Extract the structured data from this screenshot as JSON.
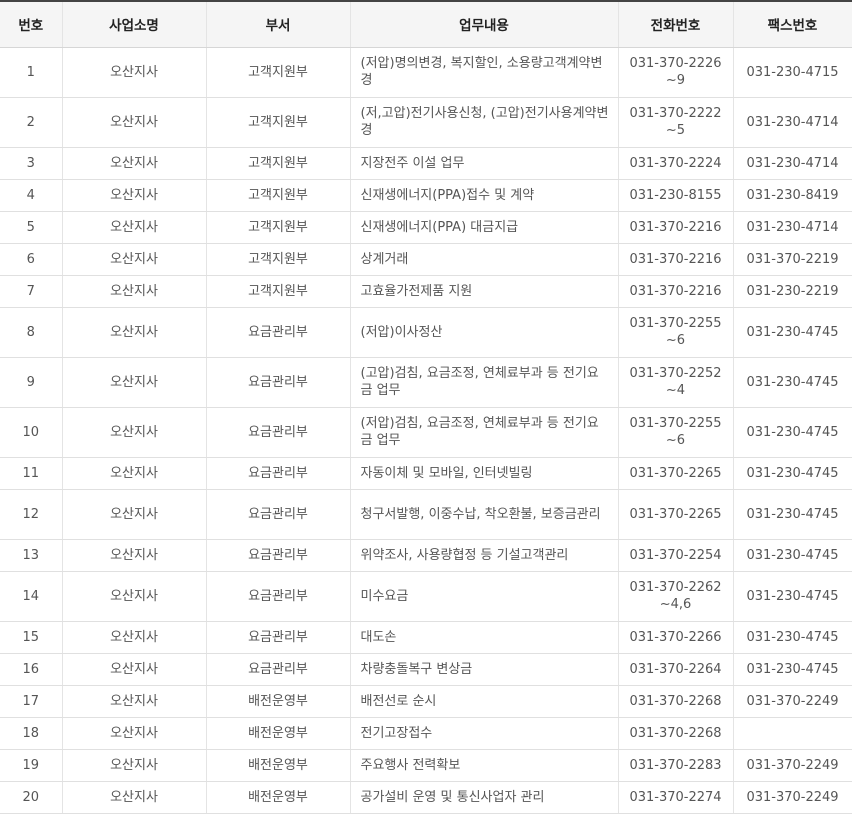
{
  "headers": [
    "번호",
    "사업소명",
    "부서",
    "업무내용",
    "전화번호",
    "팩스번호"
  ],
  "rows": [
    {
      "no": "1",
      "office": "오산지사",
      "dept": "고객지원부",
      "work": "(저압)명의변경, 복지할인, 소용량고객계약변경",
      "phone": "031-370-2226\n~9",
      "fax": "031-230-4715"
    },
    {
      "no": "2",
      "office": "오산지사",
      "dept": "고객지원부",
      "work": "(저,고압)전기사용신청, (고압)전기사용계약변경",
      "phone": "031-370-2222\n~5",
      "fax": "031-230-4714"
    },
    {
      "no": "3",
      "office": "오산지사",
      "dept": "고객지원부",
      "work": "지장전주 이설 업무",
      "phone": "031-370-2224",
      "fax": "031-230-4714"
    },
    {
      "no": "4",
      "office": "오산지사",
      "dept": "고객지원부",
      "work": "신재생에너지(PPA)접수 및 계약",
      "phone": "031-230-8155",
      "fax": "031-230-8419"
    },
    {
      "no": "5",
      "office": "오산지사",
      "dept": "고객지원부",
      "work": "신재생에너지(PPA) 대금지급",
      "phone": "031-370-2216",
      "fax": "031-230-4714"
    },
    {
      "no": "6",
      "office": "오산지사",
      "dept": "고객지원부",
      "work": "상계거래",
      "phone": "031-370-2216",
      "fax": "031-370-2219"
    },
    {
      "no": "7",
      "office": "오산지사",
      "dept": "고객지원부",
      "work": "고효율가전제품 지원",
      "phone": "031-370-2216",
      "fax": "031-230-2219"
    },
    {
      "no": "8",
      "office": "오산지사",
      "dept": "요금관리부",
      "work": "(저압)이사정산",
      "phone": "031-370-2255\n~6",
      "fax": "031-230-4745"
    },
    {
      "no": "9",
      "office": "오산지사",
      "dept": "요금관리부",
      "work": "(고압)검침, 요금조정, 연체료부과 등 전기요금 업무",
      "phone": "031-370-2252\n~4",
      "fax": "031-230-4745"
    },
    {
      "no": "10",
      "office": "오산지사",
      "dept": "요금관리부",
      "work": "(저압)검침, 요금조정, 연체료부과 등 전기요금 업무",
      "phone": "031-370-2255\n~6",
      "fax": "031-230-4745"
    },
    {
      "no": "11",
      "office": "오산지사",
      "dept": "요금관리부",
      "work": "자동이체 및 모바일, 인터넷빌링",
      "phone": "031-370-2265",
      "fax": "031-230-4745"
    },
    {
      "no": "12",
      "office": "오산지사",
      "dept": "요금관리부",
      "work": "청구서발행, 이중수납, 착오환불, 보증금관리",
      "phone": "031-370-2265",
      "fax": "031-230-4745"
    },
    {
      "no": "13",
      "office": "오산지사",
      "dept": "요금관리부",
      "work": "위약조사, 사용량협정 등 기설고객관리",
      "phone": "031-370-2254",
      "fax": "031-230-4745"
    },
    {
      "no": "14",
      "office": "오산지사",
      "dept": "요금관리부",
      "work": "미수요금",
      "phone": "031-370-2262\n~4,6",
      "fax": "031-230-4745"
    },
    {
      "no": "15",
      "office": "오산지사",
      "dept": "요금관리부",
      "work": "대도손",
      "phone": "031-370-2266",
      "fax": "031-230-4745"
    },
    {
      "no": "16",
      "office": "오산지사",
      "dept": "요금관리부",
      "work": "차량충돌복구 변상금",
      "phone": "031-370-2264",
      "fax": "031-230-4745"
    },
    {
      "no": "17",
      "office": "오산지사",
      "dept": "배전운영부",
      "work": "배전선로 순시",
      "phone": "031-370-2268",
      "fax": "031-370-2249"
    },
    {
      "no": "18",
      "office": "오산지사",
      "dept": "배전운영부",
      "work": "전기고장접수",
      "phone": "031-370-2268",
      "fax": ""
    },
    {
      "no": "19",
      "office": "오산지사",
      "dept": "배전운영부",
      "work": "주요행사 전력확보",
      "phone": "031-370-2283",
      "fax": "031-370-2249"
    },
    {
      "no": "20",
      "office": "오산지사",
      "dept": "배전운영부",
      "work": "공가설비 운영 및 통신사업자 관리",
      "phone": "031-370-2274",
      "fax": "031-370-2249"
    }
  ]
}
